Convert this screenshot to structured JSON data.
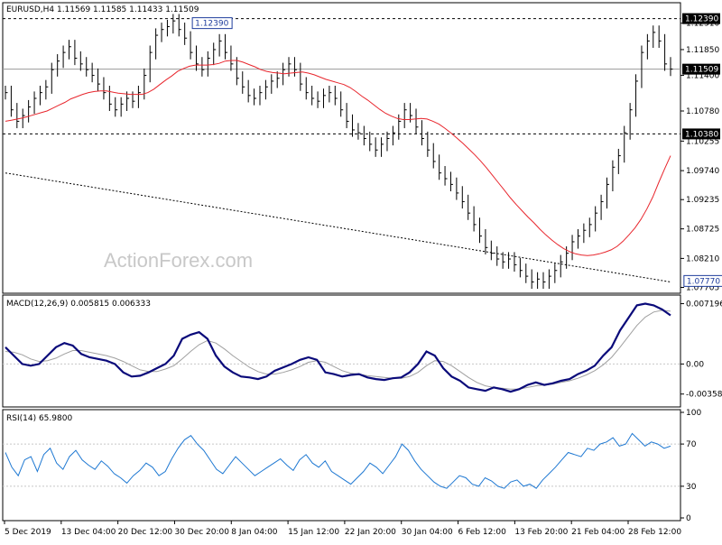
{
  "chart_data": {
    "type": "line",
    "symbol_header": "EURUSD,H4  1.11569 1.11585 1.11433 1.11509",
    "watermark": "ActionForex.com",
    "x_tick_labels": [
      "5 Dec 2019",
      "13 Dec 04:00",
      "20 Dec 12:00",
      "30 Dec 20:00",
      "8 Jan 04:00",
      "15 Jan 12:00",
      "22 Jan 20:00",
      "30 Jan 04:00",
      "6 Feb 12:00",
      "13 Feb 20:00",
      "21 Feb 04:00",
      "28 Feb 12:00"
    ],
    "colors": {
      "price": "#000000",
      "ma_fast": "#e8262d",
      "ma_slow": "#000000",
      "macd": "#0a0a7a",
      "signal": "#a0a0a0",
      "rsi": "#1e78d2",
      "level_line": "#000000",
      "grid": "#c8c8c8"
    },
    "price_panel": {
      "ylim": [
        1.0765,
        1.1262
      ],
      "y_tick_labels": [
        "1.12310",
        "1.11850",
        "1.11400",
        "1.10780",
        "1.10255",
        "1.09740",
        "1.09235",
        "1.08725",
        "1.08210",
        "1.07705"
      ],
      "y_tick_values": [
        1.1231,
        1.1185,
        1.114,
        1.1078,
        1.10255,
        1.0974,
        1.09235,
        1.08725,
        1.0821,
        1.07705
      ],
      "horizontal_levels": [
        {
          "value": 1.1239,
          "label": "1.12390"
        },
        {
          "value": 1.1038,
          "label": "1.10380"
        }
      ],
      "last_price": {
        "value": 1.11509,
        "label": "1.11509"
      },
      "annotations": [
        {
          "x": 37,
          "y": 1.1239,
          "label": "1.12390"
        },
        {
          "x": 122,
          "y": 1.0777,
          "label": "1.07770"
        }
      ],
      "series": [
        {
          "name": "price",
          "values": [
            1.111,
            1.108,
            1.106,
            1.107,
            1.1085,
            1.11,
            1.111,
            1.112,
            1.115,
            1.1165,
            1.118,
            1.119,
            1.117,
            1.116,
            1.115,
            1.114,
            1.1125,
            1.111,
            1.109,
            1.108,
            1.109,
            1.11,
            1.1095,
            1.111,
            1.114,
            1.118,
            1.121,
            1.122,
            1.1225,
            1.1235,
            1.122,
            1.1205,
            1.118,
            1.116,
            1.115,
            1.117,
            1.1185,
            1.12,
            1.118,
            1.116,
            1.1135,
            1.112,
            1.1105,
            1.11,
            1.111,
            1.112,
            1.113,
            1.1135,
            1.115,
            1.116,
            1.115,
            1.1125,
            1.111,
            1.11,
            1.1095,
            1.1105,
            1.111,
            1.11,
            1.108,
            1.106,
            1.1045,
            1.104,
            1.103,
            1.102,
            1.101,
            1.102,
            1.103,
            1.104,
            1.106,
            1.108,
            1.107,
            1.105,
            1.103,
            1.101,
            1.099,
            1.097,
            1.096,
            1.095,
            1.0935,
            1.092,
            1.09,
            1.088,
            1.086,
            1.084,
            1.083,
            1.082,
            1.0815,
            1.082,
            1.081,
            1.08,
            1.079,
            1.078,
            1.0785,
            1.078,
            1.079,
            1.08,
            1.0815,
            1.083,
            1.085,
            1.086,
            1.087,
            1.088,
            1.09,
            1.092,
            1.095,
            1.098,
            1.1,
            1.104,
            1.108,
            1.113,
            1.118,
            1.12,
            1.1215,
            1.12,
            1.116,
            1.1151
          ]
        },
        {
          "name": "ma_fast",
          "values": [
            1.106,
            1.1062,
            1.1064,
            1.1066,
            1.1069,
            1.1072,
            1.1075,
            1.1078,
            1.1083,
            1.1088,
            1.1093,
            1.1099,
            1.1103,
            1.1107,
            1.111,
            1.1112,
            1.1113,
            1.1113,
            1.1111,
            1.1109,
            1.1108,
            1.1107,
            1.1107,
            1.1107,
            1.111,
            1.1116,
            1.1124,
            1.1132,
            1.1139,
            1.1147,
            1.1152,
            1.1156,
            1.1158,
            1.1158,
            1.1158,
            1.1159,
            1.1161,
            1.1165,
            1.1166,
            1.1166,
            1.1163,
            1.1159,
            1.1155,
            1.115,
            1.1147,
            1.1145,
            1.1144,
            1.1143,
            1.1144,
            1.1145,
            1.1146,
            1.1144,
            1.1141,
            1.1137,
            1.1133,
            1.113,
            1.1127,
            1.1124,
            1.1119,
            1.1112,
            1.1104,
            1.1097,
            1.1089,
            1.1081,
            1.1074,
            1.1069,
            1.1065,
            1.1063,
            1.1063,
            1.1064,
            1.1065,
            1.1064,
            1.106,
            1.1055,
            1.1048,
            1.104,
            1.1031,
            1.1022,
            1.1012,
            1.1002,
            1.0991,
            1.0979,
            1.0966,
            1.0953,
            1.094,
            1.0927,
            1.0915,
            1.0904,
            1.0893,
            1.0883,
            1.0872,
            1.0862,
            1.0853,
            1.0845,
            1.0838,
            1.0833,
            1.0829,
            1.0827,
            1.0826,
            1.0827,
            1.0829,
            1.0832,
            1.0836,
            1.0842,
            1.0851,
            1.0862,
            1.0874,
            1.0889,
            1.0907,
            1.0928,
            1.0953,
            1.0977,
            1.1
          ]
        },
        {
          "name": "ma_slow",
          "values": [
            1.097,
            1.0968,
            1.0966,
            1.0964,
            1.0962,
            1.096,
            1.0958,
            1.0956,
            1.0954,
            1.0952,
            1.095,
            1.0948,
            1.0946,
            1.0944,
            1.0942,
            1.094,
            1.0938,
            1.0936,
            1.0934,
            1.0932,
            1.093,
            1.0928,
            1.0926,
            1.0924,
            1.0922,
            1.092,
            1.0918,
            1.0916,
            1.0914,
            1.0912,
            1.091,
            1.0908,
            1.0906,
            1.0904,
            1.0902,
            1.09,
            1.0898,
            1.0896,
            1.0894,
            1.0892,
            1.089,
            1.0888,
            1.0886,
            1.0884,
            1.0882,
            1.088,
            1.0878,
            1.0876,
            1.0874,
            1.0872,
            1.087,
            1.0868,
            1.0866,
            1.0864,
            1.0862,
            1.086,
            1.0858,
            1.0856,
            1.0854,
            1.0852,
            1.085,
            1.0848,
            1.0846,
            1.0844,
            1.0842,
            1.084,
            1.0838,
            1.0836,
            1.0834,
            1.0832,
            1.083,
            1.0828,
            1.0826,
            1.0824,
            1.0822,
            1.082,
            1.0818,
            1.0816,
            1.0814,
            1.0812,
            1.081,
            1.0808,
            1.0806,
            1.0804,
            1.0802,
            1.08,
            1.0798,
            1.0796,
            1.0794,
            1.0792,
            1.079,
            1.0788,
            1.0786,
            1.0784,
            1.0782,
            1.078
          ]
        }
      ]
    },
    "macd_panel": {
      "header": "MACD(12,26,9) 0.005815 0.006333",
      "ylim": [
        -0.0048,
        0.0079
      ],
      "y_tick_labels": [
        "0.007196",
        "0.00",
        "-0.003585"
      ],
      "y_tick_values": [
        0.007196,
        0.0,
        -0.003585
      ],
      "series": [
        {
          "name": "macd",
          "values": [
            0.002,
            0.001,
            0.0,
            -0.0002,
            0.0,
            0.001,
            0.002,
            0.0025,
            0.0022,
            0.0012,
            0.0008,
            0.0006,
            0.0004,
            0.0,
            -0.001,
            -0.0015,
            -0.0014,
            -0.001,
            -0.0005,
            0.0,
            0.001,
            0.003,
            0.0035,
            0.0038,
            0.003,
            0.001,
            -0.0003,
            -0.001,
            -0.0015,
            -0.0016,
            -0.0018,
            -0.0015,
            -0.0008,
            -0.0004,
            0.0,
            0.0005,
            0.0008,
            0.0005,
            -0.001,
            -0.0012,
            -0.0015,
            -0.0013,
            -0.0012,
            -0.0016,
            -0.0018,
            -0.0019,
            -0.0017,
            -0.0016,
            -0.001,
            0.0,
            0.0015,
            0.001,
            -0.0005,
            -0.0015,
            -0.002,
            -0.0028,
            -0.003,
            -0.0032,
            -0.0028,
            -0.003,
            -0.0033,
            -0.003,
            -0.0025,
            -0.0022,
            -0.0025,
            -0.0023,
            -0.002,
            -0.0018,
            -0.0012,
            -0.0008,
            -0.0002,
            0.001,
            0.002,
            0.004,
            0.0055,
            0.007,
            0.0072,
            0.007,
            0.0065,
            0.0058
          ]
        },
        {
          "name": "signal",
          "values": [
            0.0015,
            0.0014,
            0.0011,
            0.0006,
            0.0003,
            0.0004,
            0.0007,
            0.0012,
            0.0016,
            0.0016,
            0.0014,
            0.0012,
            0.001,
            0.0007,
            0.0003,
            -0.0002,
            -0.0007,
            -0.0009,
            -0.0009,
            -0.0006,
            -0.0002,
            0.0006,
            0.0015,
            0.0023,
            0.0028,
            0.0025,
            0.0018,
            0.001,
            0.0003,
            -0.0004,
            -0.0009,
            -0.0012,
            -0.0012,
            -0.001,
            -0.0007,
            -0.0003,
            0.0002,
            0.0004,
            0.0002,
            -0.0003,
            -0.0008,
            -0.0011,
            -0.0012,
            -0.0014,
            -0.0015,
            -0.0016,
            -0.0017,
            -0.0017,
            -0.0015,
            -0.001,
            -0.0002,
            0.0004,
            0.0003,
            -0.0002,
            -0.0009,
            -0.0016,
            -0.0022,
            -0.0026,
            -0.0028,
            -0.0029,
            -0.003,
            -0.003,
            -0.0028,
            -0.0026,
            -0.0025,
            -0.0024,
            -0.0022,
            -0.002,
            -0.0017,
            -0.0013,
            -0.0008,
            -0.0001,
            0.0008,
            0.002,
            0.0033,
            0.0046,
            0.0056,
            0.0062,
            0.0064,
            0.0063
          ]
        }
      ]
    },
    "rsi_panel": {
      "header": "RSI(14) 65.9800",
      "ylim": [
        0,
        100
      ],
      "y_tick_labels": [
        "100",
        "70",
        "30",
        "0"
      ],
      "y_tick_values": [
        100,
        70,
        30,
        0
      ],
      "reference_levels": [
        70,
        30
      ],
      "series": [
        {
          "name": "rsi",
          "values": [
            62,
            48,
            40,
            55,
            58,
            44,
            60,
            66,
            52,
            46,
            58,
            64,
            55,
            50,
            46,
            54,
            49,
            42,
            38,
            33,
            40,
            45,
            52,
            48,
            40,
            44,
            56,
            66,
            74,
            78,
            70,
            64,
            55,
            46,
            42,
            50,
            58,
            52,
            46,
            40,
            44,
            48,
            52,
            56,
            50,
            45,
            55,
            60,
            52,
            48,
            54,
            44,
            40,
            36,
            32,
            38,
            44,
            52,
            48,
            42,
            50,
            58,
            70,
            64,
            54,
            46,
            40,
            34,
            30,
            28,
            34,
            40,
            38,
            32,
            30,
            38,
            35,
            30,
            28,
            34,
            36,
            30,
            32,
            28,
            36,
            42,
            48,
            55,
            62,
            60,
            58,
            66,
            64,
            70,
            72,
            76,
            68,
            70,
            80,
            74,
            68,
            72,
            70,
            66,
            68
          ]
        }
      ]
    }
  }
}
